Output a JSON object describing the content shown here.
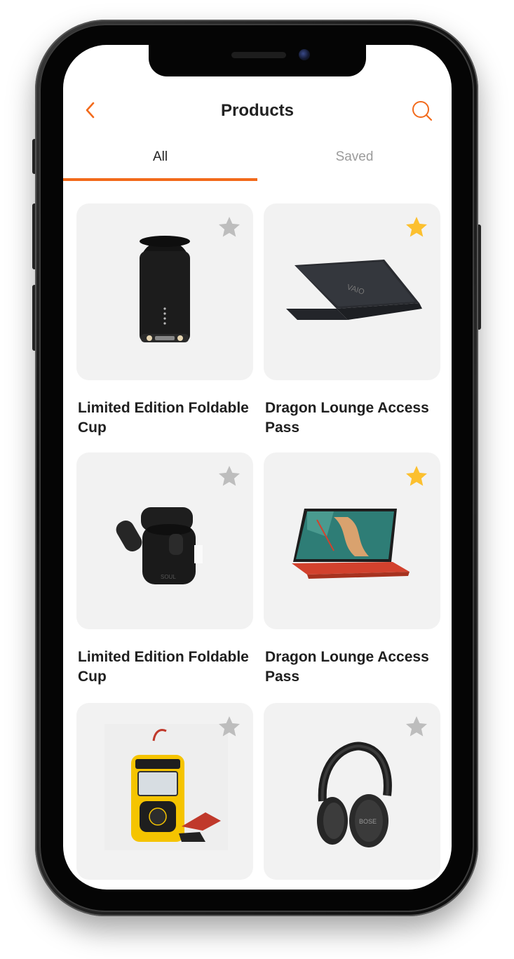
{
  "header": {
    "title": "Products",
    "back_icon": "chevron-left-icon",
    "search_icon": "search-icon",
    "accent_color": "#f26a1b"
  },
  "tabs": [
    {
      "label": "All",
      "active": true
    },
    {
      "label": "Saved",
      "active": false
    }
  ],
  "products": [
    {
      "title": "Limited Edition Foldable Cup",
      "image": "cylindrical-speaker-image",
      "saved": false
    },
    {
      "title": "Dragon Lounge Access Pass",
      "image": "laptop-image",
      "saved": true
    },
    {
      "title": "Limited Edition Foldable Cup",
      "image": "earbuds-case-image",
      "saved": false
    },
    {
      "title": "Dragon Lounge Access Pass",
      "image": "convertible-laptop-image",
      "saved": true
    },
    {
      "title": "",
      "image": "battery-tester-image",
      "saved": false
    },
    {
      "title": "",
      "image": "headphones-image",
      "saved": false
    }
  ],
  "colors": {
    "star_saved": "#fcc02f",
    "star_unsaved": "#bdbdbd",
    "card_bg": "#f2f2f2"
  }
}
